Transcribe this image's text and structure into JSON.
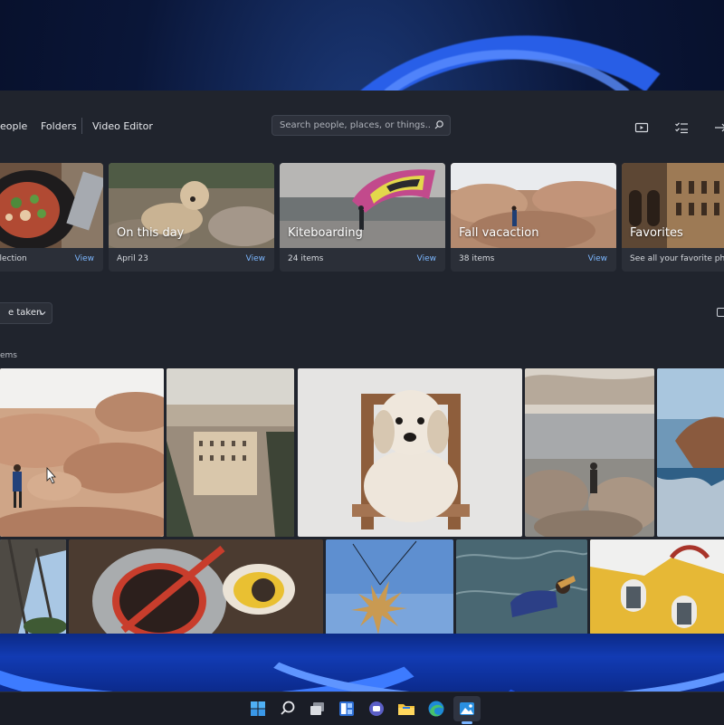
{
  "nav": {
    "people": "eople",
    "folders": "Folders",
    "video_editor": "Video Editor"
  },
  "search": {
    "placeholder": "Search people, places, or things..."
  },
  "toolbar_icons": [
    "slideshow-icon",
    "select-icon",
    "import-icon"
  ],
  "albums": [
    {
      "title": "",
      "subtitle": "llection",
      "action": "View"
    },
    {
      "title": "On this day",
      "subtitle": "April 23",
      "action": "View"
    },
    {
      "title": "Kiteboarding",
      "subtitle": "24 items",
      "action": "View"
    },
    {
      "title": "Fall vacaction",
      "subtitle": "38 items",
      "action": "View"
    },
    {
      "title": "Favorites",
      "subtitle": "See all your favorite photo",
      "action": ""
    }
  ],
  "sort": {
    "label": "e taken"
  },
  "gallery": {
    "count_label": "ems"
  },
  "taskbar": {
    "icons": [
      "start-icon",
      "search-icon",
      "task-view-icon",
      "widgets-icon",
      "chat-icon",
      "file-explorer-icon",
      "edge-icon",
      "photos-icon"
    ],
    "active": "photos-icon"
  },
  "colors": {
    "app_bg": "#20242d",
    "card_bg": "#2b2f38",
    "link": "#7cb7ff",
    "accent": "#2a62f0"
  }
}
